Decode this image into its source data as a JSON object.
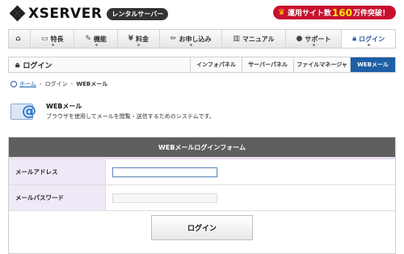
{
  "header": {
    "logo_text": "XSERVER",
    "logo_tag": "レンタルサーバー",
    "promo_prefix": "運用サイト数",
    "promo_number": "160",
    "promo_suffix": "万件突破！"
  },
  "nav": {
    "items": [
      {
        "label": "",
        "icon": "home-icon"
      },
      {
        "label": "特長",
        "icon": "monitor-icon"
      },
      {
        "label": "機能",
        "icon": "wrench-icon"
      },
      {
        "label": "料金",
        "icon": "yen-icon"
      },
      {
        "label": "お申し込み",
        "icon": "pencil-icon"
      },
      {
        "label": "マニュアル",
        "icon": "book-icon"
      },
      {
        "label": "サポート",
        "icon": "user-icon"
      },
      {
        "label": "ログイン",
        "icon": "lock-icon"
      }
    ]
  },
  "subbar": {
    "title": "ログイン",
    "tabs": [
      "インフォパネル",
      "サーバーパネル",
      "ファイルマネージャ",
      "WEBメール"
    ]
  },
  "breadcrumb": {
    "home": "ホーム",
    "login": "ログイン",
    "current": "WEBメール"
  },
  "intro": {
    "title": "WEBメール",
    "desc": "ブラウザを使用してメールを閲覧・送信するためのシステムです。"
  },
  "form": {
    "heading": "WEBメールログインフォーム",
    "address_label": "メールアドレス",
    "address_value": "",
    "password_label": "メールパスワード",
    "password_value": "",
    "submit_label": "ログイン"
  }
}
